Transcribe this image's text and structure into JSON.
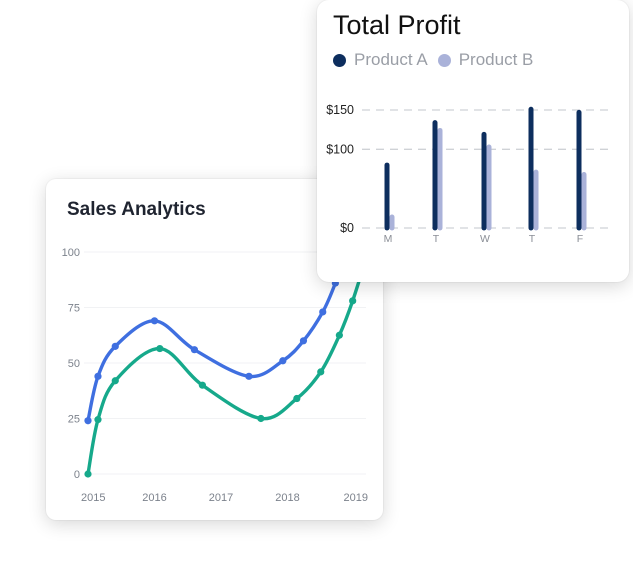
{
  "sales_card": {
    "title": "Sales Analytics"
  },
  "profit_card": {
    "title": "Total Profit",
    "legend": [
      {
        "label": "Product A",
        "color": "#0d2e5e"
      },
      {
        "label": "Product B",
        "color": "#aab2d9"
      }
    ]
  },
  "chart_data": [
    {
      "type": "line",
      "title": "Sales Analytics",
      "xlabel": "",
      "ylabel": "",
      "xlim": [
        2015,
        2019
      ],
      "ylim": [
        0,
        100
      ],
      "x_ticks": [
        "2015",
        "2016",
        "2017",
        "2018",
        "2019"
      ],
      "y_ticks": [
        "0",
        "25",
        "50",
        "75",
        "100"
      ],
      "grid": "horizontal",
      "series": [
        {
          "color": "#3f6fe0",
          "x": [
            2015,
            2015.15,
            2015.41,
            2016.0,
            2016.6,
            2017.42,
            2017.93,
            2018.24,
            2018.53,
            2018.72
          ],
          "y": [
            24,
            44,
            57.5,
            69,
            56,
            44,
            51,
            60,
            73,
            86
          ]
        },
        {
          "color": "#16a98b",
          "x": [
            2015,
            2015.15,
            2015.41,
            2016.08,
            2016.72,
            2017.6,
            2018.14,
            2018.5,
            2018.78,
            2018.98
          ],
          "y": [
            0,
            24.5,
            42,
            56.5,
            40,
            25,
            34,
            46,
            62.5,
            78
          ]
        }
      ]
    },
    {
      "type": "bar",
      "title": "Total Profit",
      "categories": [
        "M",
        "T",
        "W",
        "T",
        "F"
      ],
      "y_ticks": [
        "$0",
        "$100",
        "$150"
      ],
      "ylim": [
        0,
        150
      ],
      "legend_position": "top-left",
      "grid": "horizontal-dashed",
      "series": [
        {
          "name": "Product A",
          "color": "#0d2e5e",
          "values": [
            80,
            134,
            119,
            151,
            147
          ]
        },
        {
          "name": "Product B",
          "color": "#aab2d9",
          "values": [
            14,
            124,
            103,
            71,
            68
          ]
        }
      ]
    }
  ]
}
